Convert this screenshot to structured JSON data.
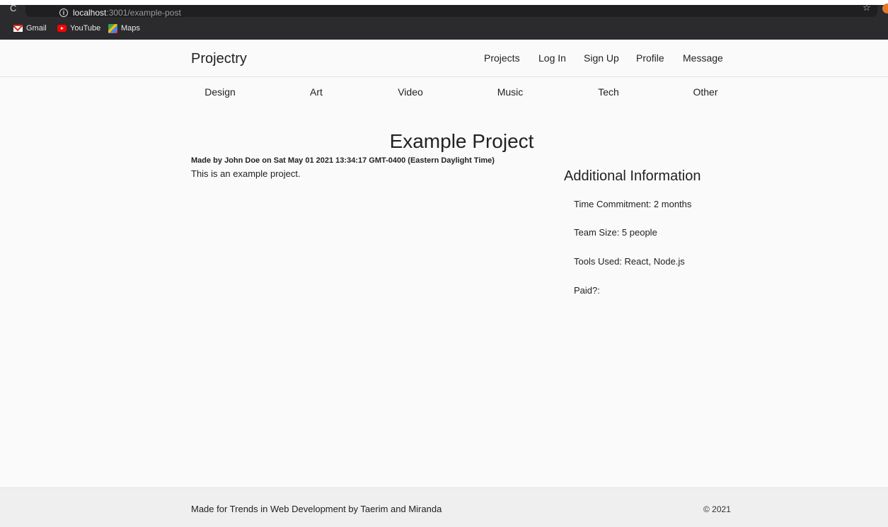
{
  "browser": {
    "url_host": "localhost",
    "url_path": ":3001/example-post",
    "bookmarks": [
      {
        "label": "Gmail",
        "icon": "gmail-icon"
      },
      {
        "label": "YouTube",
        "icon": "youtube-icon"
      },
      {
        "label": "Maps",
        "icon": "maps-icon"
      }
    ]
  },
  "navbar": {
    "brand": "Projectry",
    "links": [
      "Projects",
      "Log In",
      "Sign Up",
      "Profile",
      "Message"
    ]
  },
  "categories": [
    "Design",
    "Art",
    "Video",
    "Music",
    "Tech",
    "Other"
  ],
  "project": {
    "title": "Example Project",
    "meta": "Made by John Doe on Sat May 01 2021 13:34:17 GMT-0400 (Eastern Daylight Time)",
    "description": "This is an example project."
  },
  "additional_info": {
    "heading": "Additional Information",
    "items": [
      "Time Commitment: 2 months",
      "Team Size: 5 people",
      "Tools Used: React, Node.js",
      "Paid?:"
    ]
  },
  "footer": {
    "text": "Made for Trends in Web Development by Taerim and Miranda",
    "copyright": "© 2021"
  },
  "colors": {
    "page_background": "#fafafa",
    "browser_chrome": "#2b2b2e",
    "footer_background": "#efefef",
    "text": "#222222"
  }
}
